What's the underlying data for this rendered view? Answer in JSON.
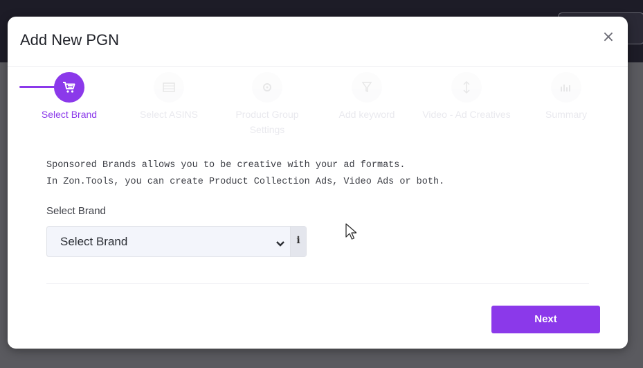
{
  "modal": {
    "title": "Add New PGN",
    "close_label": "×"
  },
  "stepper": {
    "steps": [
      {
        "label": "Select Brand",
        "icon": "cart-icon",
        "state": "active"
      },
      {
        "label": "Select ASINS",
        "icon": "table-icon",
        "state": "inactive"
      },
      {
        "label": "Product Group Settings",
        "icon": "gear-icon",
        "state": "inactive"
      },
      {
        "label": "Add keyword",
        "icon": "filter-icon",
        "state": "inactive"
      },
      {
        "label": "Video - Ad Creatives",
        "icon": "sort-icon",
        "state": "inactive"
      },
      {
        "label": "Summary",
        "icon": "bar-chart-icon",
        "state": "inactive"
      }
    ]
  },
  "intro": {
    "line1": "Sponsored Brands allows you to be creative with your ad formats.",
    "line2": "In Zon.Tools, you can create Product Collection Ads, Video Ads or both."
  },
  "brand_field": {
    "label": "Select Brand",
    "selected": "Select Brand",
    "info_label": "i"
  },
  "actions": {
    "next_label": "Next"
  },
  "colors": {
    "accent": "#8b39ea",
    "topbar": "#1d1c27"
  }
}
